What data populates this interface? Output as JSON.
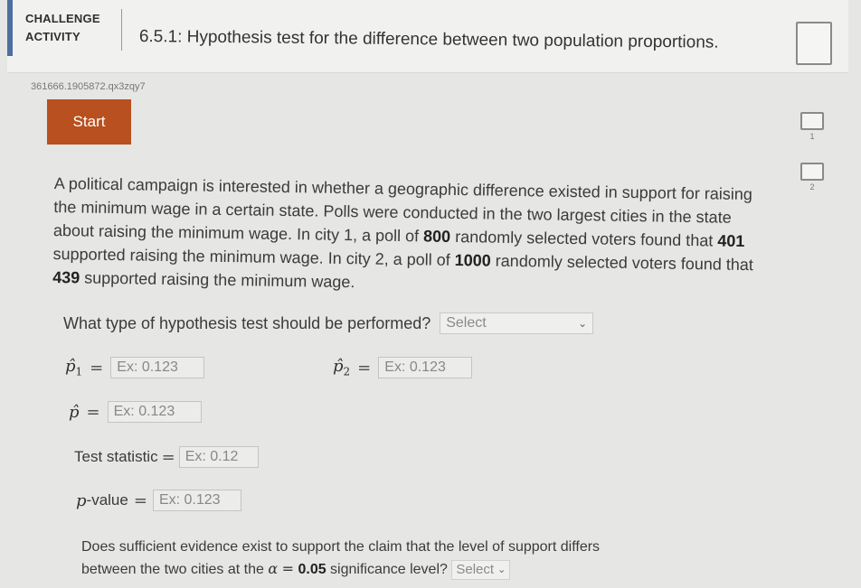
{
  "header": {
    "label_line1": "CHALLENGE",
    "label_line2": "ACTIVITY",
    "title": "6.5.1: Hypothesis test for the difference between two population proportions."
  },
  "activity_id": "361666.1905872.qx3zqy7",
  "start_label": "Start",
  "levels": [
    "1",
    "2"
  ],
  "problem": {
    "part1": "A political campaign is interested in whether a geographic difference existed in support for raising the minimum wage in a certain state. Polls were conducted in the two largest cities in the state about raising the minimum wage. In city 1, a poll of ",
    "n1": "800",
    "part2": " randomly selected voters found that ",
    "x1": "401",
    "part3": " supported raising the minimum wage. In city 2, a poll of ",
    "n2": "1000",
    "part4": " randomly selected voters found that ",
    "x2": "439",
    "part5": " supported raising the minimum wage."
  },
  "question_type": {
    "label": "What type of hypothesis test should be performed?",
    "select_value": "Select"
  },
  "fields": {
    "p1_symbol": "p̂",
    "p1_sub": "1",
    "p1_placeholder": "Ex: 0.123",
    "p2_symbol": "p̂",
    "p2_sub": "2",
    "p2_placeholder": "Ex: 0.123",
    "p_symbol": "p̂",
    "p_placeholder": "Ex: 0.123",
    "test_stat_label": "Test statistic",
    "test_stat_placeholder": "Ex: 0.12",
    "pvalue_p": "p",
    "pvalue_label": "-value",
    "pvalue_placeholder": "Ex: 0.123",
    "equals": "="
  },
  "conclusion": {
    "line1": "Does sufficient evidence exist to support the claim that the level of support differs",
    "line2_start": "between the two cities at the ",
    "alpha": "α",
    "alpha_value": "0.05",
    "line2_end": " significance level?",
    "select_value": "Select"
  },
  "colors": {
    "accent": "#4d6fa0",
    "start_button": "#b8501f"
  }
}
